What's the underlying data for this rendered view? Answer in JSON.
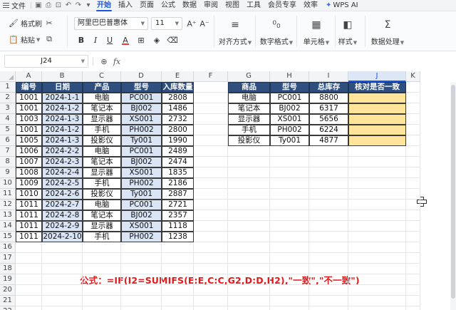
{
  "topbar": {
    "file_menu": "文件",
    "tabs": [
      "开始",
      "插入",
      "页面",
      "公式",
      "数据",
      "审阅",
      "视图",
      "工具",
      "会员专享",
      "效率"
    ],
    "active_tab": "开始",
    "ai_label": "WPS AI"
  },
  "ribbon": {
    "format_painter": "格式刷",
    "paste": "粘贴",
    "font_name": "阿里巴巴普惠体",
    "font_size": "11",
    "align": "对齐方式",
    "number_format": "数字格式",
    "cells": "单元格",
    "styles": "样式",
    "data_processing": "数据处理"
  },
  "formula_bar": {
    "cell_ref": "J24",
    "formula": ""
  },
  "columns": [
    "A",
    "B",
    "C",
    "D",
    "E",
    "F",
    "G",
    "H",
    "I",
    "J",
    "K"
  ],
  "selected_column": "J",
  "rows": [
    "1",
    "2",
    "3",
    "4",
    "5",
    "6",
    "7",
    "8",
    "9",
    "10",
    "11",
    "12",
    "13",
    "14",
    "15",
    "16",
    "17",
    "18",
    "19",
    "20",
    "21",
    "22"
  ],
  "table1": {
    "headers": [
      "编号",
      "日期",
      "产品",
      "型号",
      "入库数量"
    ],
    "rows": [
      [
        "1001",
        "2024-1-1",
        "电脑",
        "PC001",
        "2808"
      ],
      [
        "1001",
        "2024-1-2",
        "笔记本",
        "BJ002",
        "1486"
      ],
      [
        "1003",
        "2024-1-3",
        "显示器",
        "XS001",
        "2732"
      ],
      [
        "1001",
        "2024-1-2",
        "手机",
        "PH002",
        "2800"
      ],
      [
        "1005",
        "2024-1-3",
        "投影仪",
        "Ty001",
        "1990"
      ],
      [
        "1006",
        "2024-2-2",
        "电脑",
        "PC001",
        "2489"
      ],
      [
        "1007",
        "2024-2-3",
        "笔记本",
        "BJ002",
        "2474"
      ],
      [
        "1008",
        "2024-2-4",
        "显示器",
        "XS001",
        "1835"
      ],
      [
        "1009",
        "2024-2-5",
        "手机",
        "PH002",
        "2186"
      ],
      [
        "1010",
        "2024-2-6",
        "投影仪",
        "Ty001",
        "2887"
      ],
      [
        "1011",
        "2024-2-7",
        "电脑",
        "PC001",
        "2721"
      ],
      [
        "1011",
        "2024-2-8",
        "笔记本",
        "BJ002",
        "2357"
      ],
      [
        "1011",
        "2024-2-9",
        "显示器",
        "XS001",
        "1118"
      ],
      [
        "1011",
        "2024-2-10",
        "手机",
        "PH002",
        "1238"
      ]
    ]
  },
  "table2": {
    "headers": [
      "商品",
      "型号",
      "总库存",
      "核对是否一致"
    ],
    "rows": [
      [
        "电脑",
        "PC001",
        "8800",
        ""
      ],
      [
        "笔记本",
        "BJ002",
        "6317",
        ""
      ],
      [
        "显示器",
        "XS001",
        "5656",
        ""
      ],
      [
        "手机",
        "PH002",
        "6224",
        ""
      ],
      [
        "投影仪",
        "Ty001",
        "4877",
        ""
      ]
    ]
  },
  "annotation": "公式：=IF(I2=SUMIFS(E:E,C:C,G2,D:D,H2),\"一致\",\"不一致\")",
  "colors": {
    "header_fill": "#2f4f7f",
    "blue_fill": "#d9e4f5",
    "yellow_fill": "#ffe49a",
    "annotation": "#e3191b",
    "accent": "#1a56db"
  }
}
